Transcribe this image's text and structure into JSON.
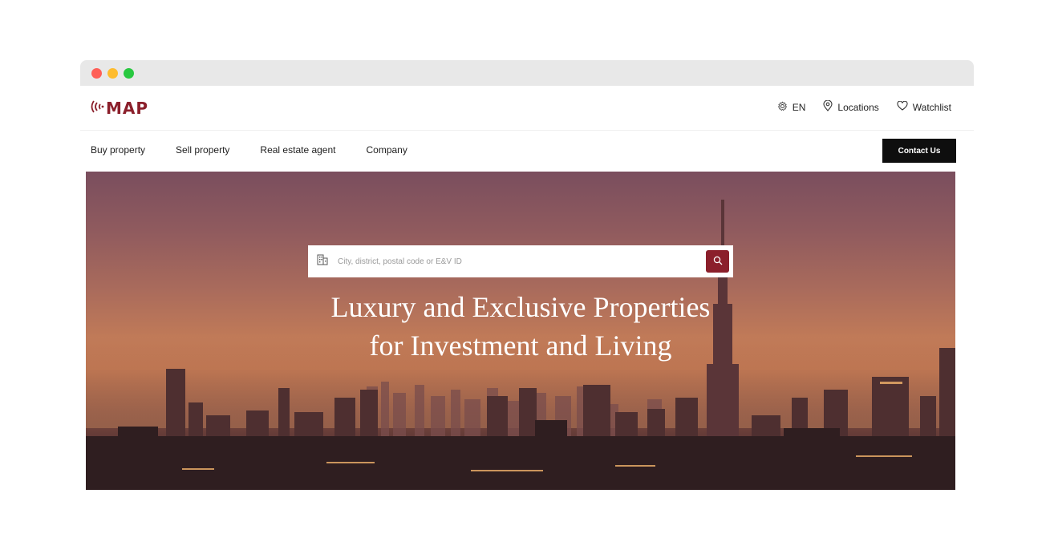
{
  "logo": {
    "text": "MAP",
    "icon": "signal-waves-icon",
    "color": "#8b1f2b"
  },
  "utility": {
    "language": {
      "label": "EN",
      "icon": "gear-icon"
    },
    "locations": {
      "label": "Locations",
      "icon": "location-pin-icon"
    },
    "watchlist": {
      "label": "Watchlist",
      "icon": "heart-icon"
    }
  },
  "nav": {
    "items": [
      {
        "label": "Buy property"
      },
      {
        "label": "Sell property"
      },
      {
        "label": "Real estate agent"
      },
      {
        "label": "Company"
      }
    ],
    "contact_label": "Contact Us"
  },
  "hero": {
    "search": {
      "placeholder": "City, district, postal code or E&V ID",
      "icon": "building-icon",
      "button_icon": "search-icon"
    },
    "headline_line1": "Luxury and Exclusive Properties",
    "headline_line2": "for Investment and Living"
  },
  "colors": {
    "accent": "#8b1f2b",
    "button_dark": "#0e0e0e"
  }
}
